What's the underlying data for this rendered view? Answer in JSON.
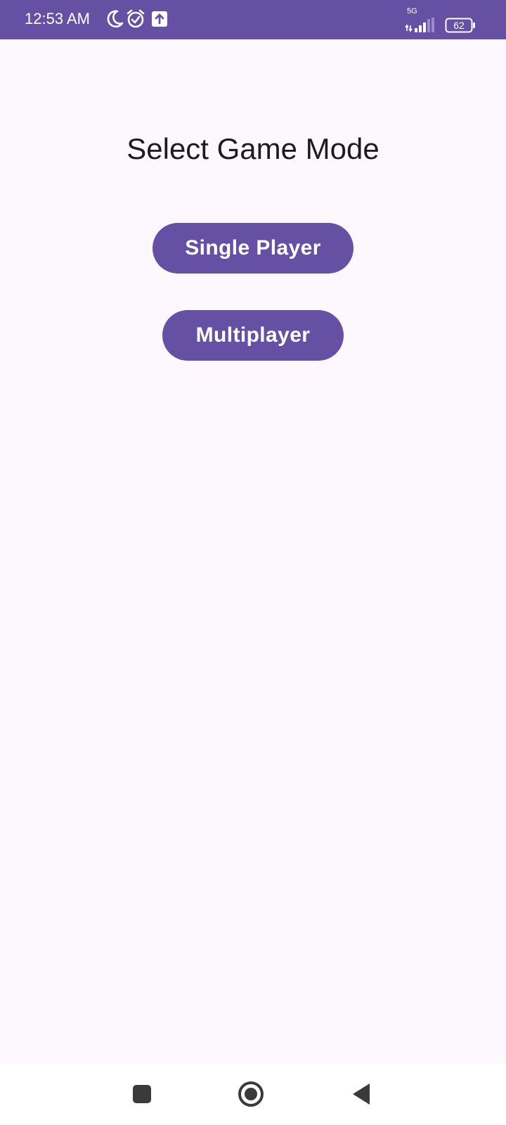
{
  "status_bar": {
    "time": "12:53 AM",
    "icons": [
      "moon-icon",
      "alarm-icon",
      "upload-icon"
    ],
    "network": "5G",
    "battery_level": "62",
    "background": "#6650a4"
  },
  "main": {
    "title": "Select Game Mode",
    "buttons": [
      {
        "label": "Single Player"
      },
      {
        "label": "Multiplayer"
      }
    ],
    "accent_color": "#6650a4",
    "background": "#fdf7fe"
  },
  "nav_bar": {
    "icons": [
      "recent-apps-icon",
      "home-icon",
      "back-icon"
    ]
  }
}
